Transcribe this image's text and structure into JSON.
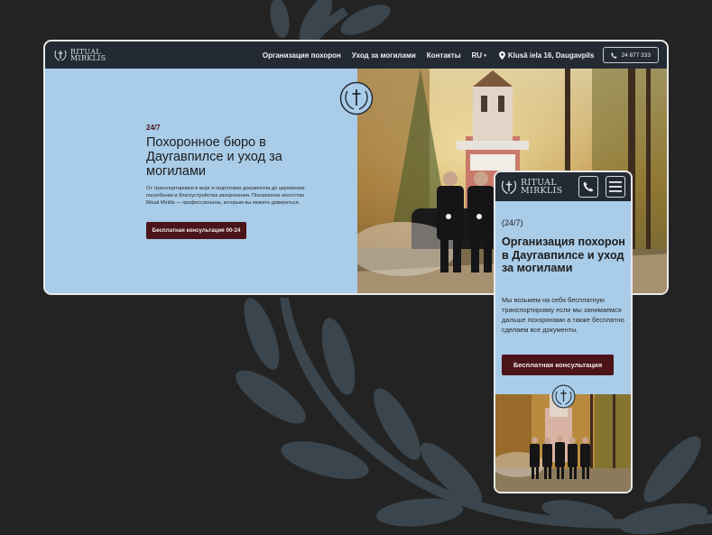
{
  "colors": {
    "background": "#232323",
    "leaf": "#3a454d",
    "header": "#232a33",
    "hero": "#a9cce8",
    "accent": "#4a1419"
  },
  "desktop": {
    "logo": {
      "icon": "wreath-cross-icon",
      "text": "RITUAL\nMIRKLIS"
    },
    "nav": [
      "Организация похорон",
      "Уход за могилами",
      "Контакты"
    ],
    "language": "RU",
    "address": {
      "icon": "map-pin-icon",
      "text": "Klusā iela 16, Daugavpils"
    },
    "phone": {
      "icon": "phone-icon",
      "text": "24 877 333"
    },
    "hero": {
      "tag": "24/7",
      "title": "Похоронное бюро в Даугавпилсе и уход за могилами",
      "description": "От транспортировки в морг и подготовки документов до церемонии погребения и благоустройства захоронения. Похоронное агентство Ritual Mirklis — профессионалы, которым вы можете довериться.",
      "cta": "Бесплатная консультация 00-24"
    },
    "emblem": "wreath-cross-emblem-icon"
  },
  "mobile": {
    "logo": {
      "icon": "wreath-cross-icon",
      "text": "RITUAL\nMIRKLIS"
    },
    "phone_icon": "phone-icon",
    "menu_icon": "hamburger-menu-icon",
    "hero": {
      "tag": "(24/7)",
      "title": "Организация похорон в Даугавпилсе и уход за могилами",
      "description": "Мы возьмем на себя бесплатную транспортировку если мы занимаемся дальше похоронами а также бесплатно сделаем все документы.",
      "cta": "Бесплатная консультация"
    },
    "emblem": "wreath-cross-emblem-icon"
  }
}
